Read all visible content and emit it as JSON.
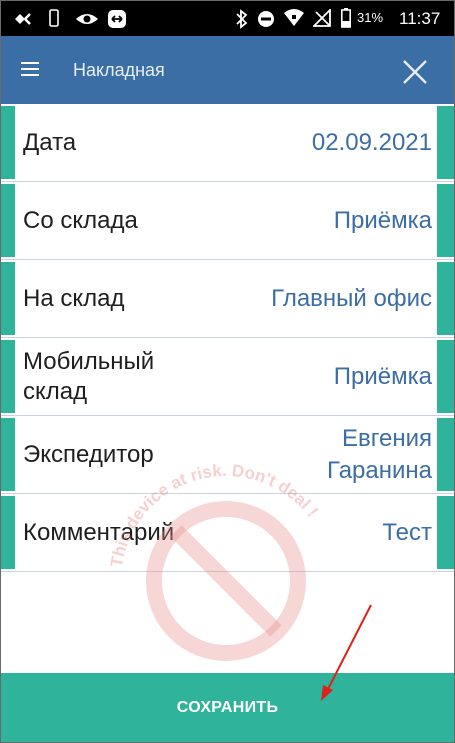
{
  "status_bar": {
    "battery": "31%",
    "time": "11:37",
    "icons": [
      "usb-debug-icon",
      "phone-icon",
      "eye-icon",
      "remote-icon",
      "bluetooth-icon",
      "do-not-disturb-icon",
      "wifi-icon",
      "no-signal-icon",
      "battery-icon"
    ]
  },
  "app_bar": {
    "title": "Накладная",
    "menu_icon": "hamburger-menu-icon",
    "close_icon": "close-icon",
    "color": "#3b6ea5"
  },
  "fields": [
    {
      "label": "Дата",
      "value": "02.09.2021"
    },
    {
      "label": "Со склада",
      "value": "Приёмка"
    },
    {
      "label": "На склад",
      "value": "Главный офис"
    },
    {
      "label": "Мобильный склад",
      "value": "Приёмка"
    },
    {
      "label": "Экспедитор",
      "value": "Евгения Гаранина"
    },
    {
      "label": "Комментарий",
      "value": "Тест"
    }
  ],
  "watermark": {
    "text": "This device at risk. Don't deal !"
  },
  "footer": {
    "save_label": "СОХРАНИТЬ",
    "accent": "#2fb39a"
  }
}
